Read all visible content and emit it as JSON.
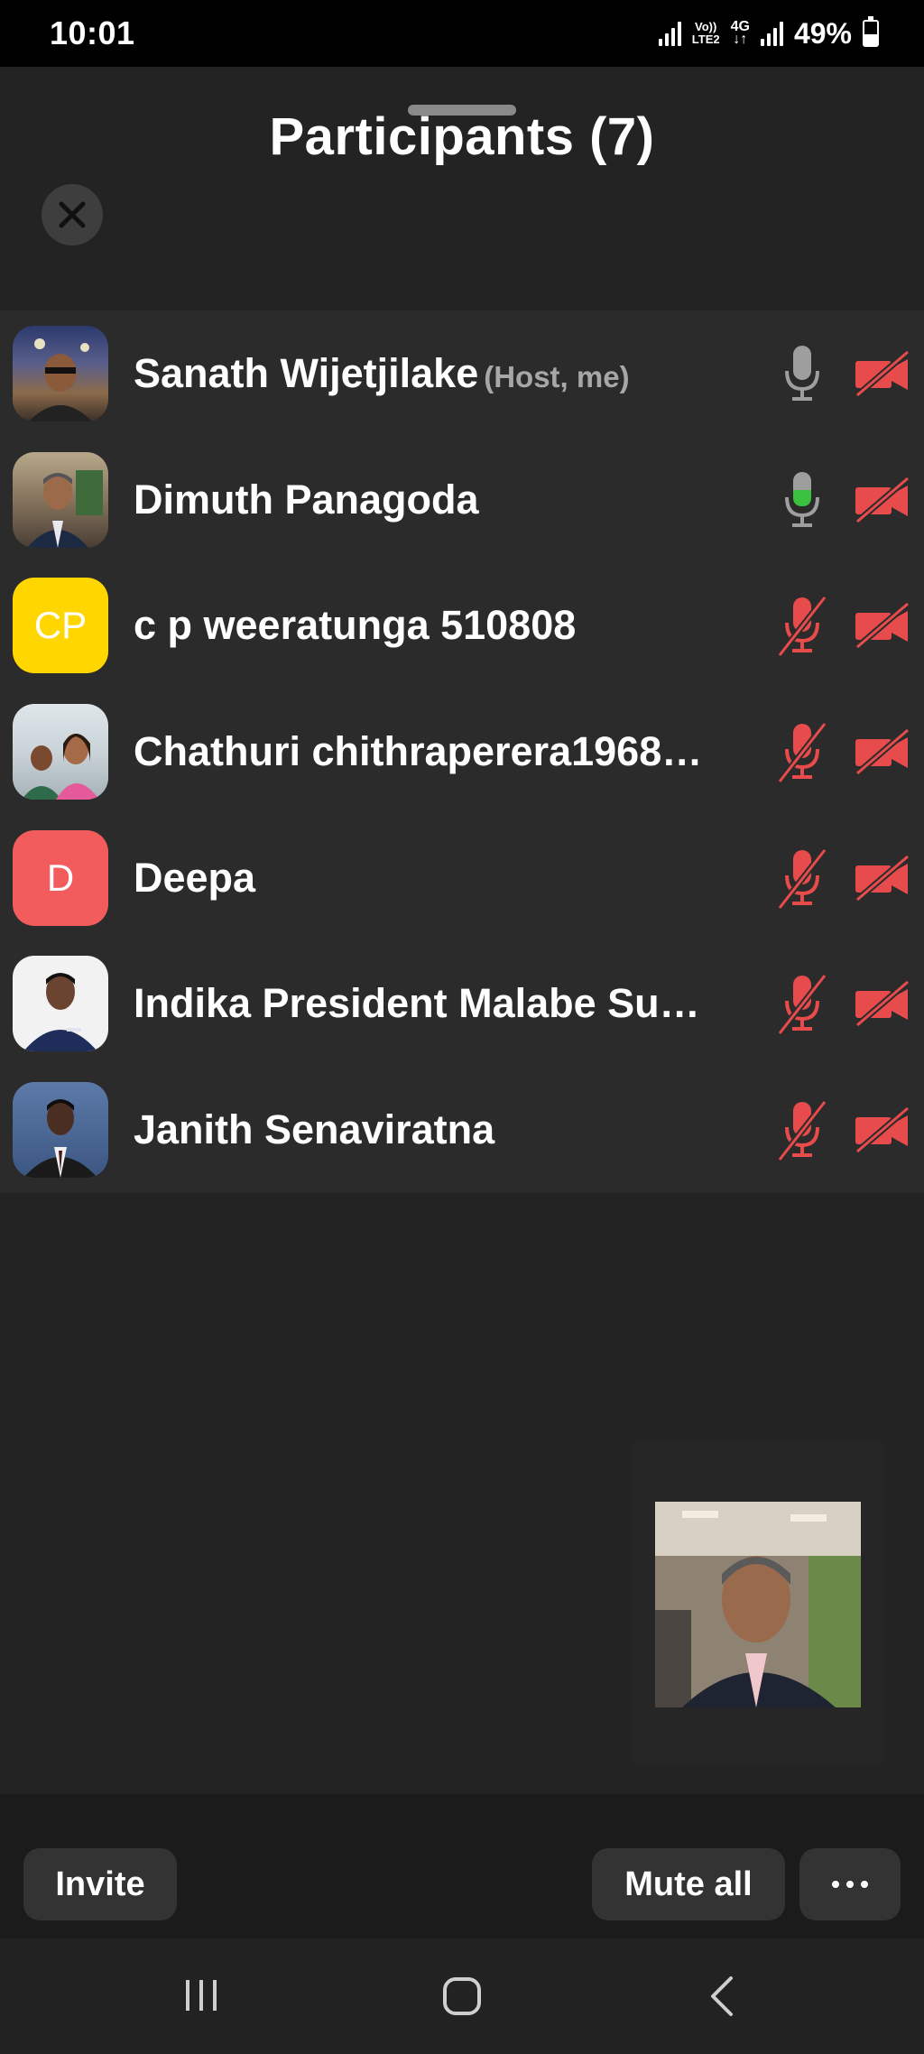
{
  "status_bar": {
    "time": "10:01",
    "network_top": "Vo))",
    "network_bottom": "LTE2",
    "network_type": "4G",
    "battery": "49%"
  },
  "header": {
    "title": "Participants (7)",
    "close_icon": "close-icon"
  },
  "participants": [
    {
      "name": "Sanath Wijetjilake",
      "tag": "(Host, me)",
      "avatar": "photo",
      "mic": "on",
      "mic_active": false,
      "video": "off"
    },
    {
      "name": "Dimuth Panagoda",
      "tag": "",
      "avatar": "photo",
      "mic": "on",
      "mic_active": true,
      "video": "off"
    },
    {
      "name": "c p weeratunga 510808",
      "tag": "",
      "avatar_initials": "CP",
      "avatar_color": "#FFD600",
      "mic": "muted",
      "video": "off"
    },
    {
      "name": "Chathuri chithraperera1968…",
      "tag": "",
      "avatar": "photo",
      "mic": "muted",
      "video": "off"
    },
    {
      "name": "Deepa",
      "tag": "",
      "avatar_initials": "D",
      "avatar_color": "#F25C5C",
      "mic": "muted",
      "video": "off"
    },
    {
      "name": "Indika President Malabe Su…",
      "tag": "",
      "avatar": "photo",
      "mic": "muted",
      "video": "off"
    },
    {
      "name": "Janith Senaviratna",
      "tag": "",
      "avatar": "photo",
      "mic": "muted",
      "video": "off"
    }
  ],
  "actions": {
    "invite": "Invite",
    "mute_all": "Mute all",
    "more": "···"
  },
  "colors": {
    "muted_red": "#E84B4B",
    "mic_gray": "#9E9E9E",
    "mic_active_green": "#39C13F"
  }
}
